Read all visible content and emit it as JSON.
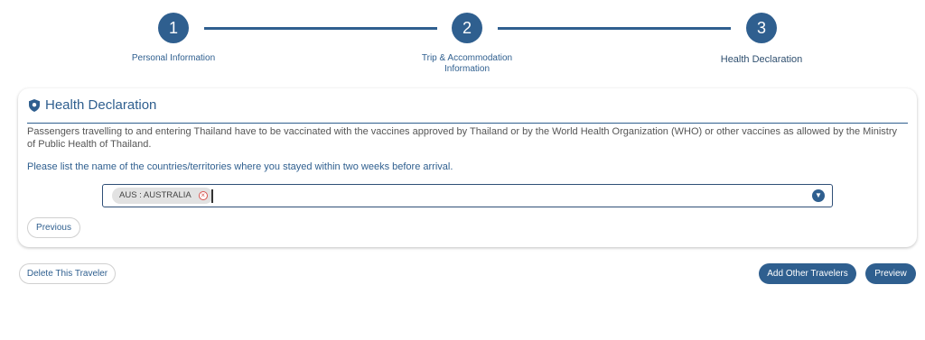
{
  "stepper": {
    "steps": [
      {
        "number": "1",
        "label": "Personal Information"
      },
      {
        "number": "2",
        "label_line1": "Trip & Accommodation",
        "label_line2": "Information"
      },
      {
        "number": "3",
        "label": "Health Declaration"
      }
    ]
  },
  "card": {
    "title": "Health Declaration",
    "description": "Passengers travelling to and entering Thailand have to be vaccinated with the vaccines approved by Thailand or by the World Health Organization (WHO) or other vaccines as allowed by the Ministry of Public Health of Thailand.",
    "question": "Please list the name of the countries/territories where you stayed within two weeks before arrival.",
    "selected_country": "AUS : AUSTRALIA",
    "previous_label": "Previous"
  },
  "actions": {
    "delete_label": "Delete This Traveler",
    "add_label": "Add Other Travelers",
    "preview_label": "Preview"
  },
  "colors": {
    "primary": "#2f5f8f",
    "remove_chip": "#d9534f"
  }
}
